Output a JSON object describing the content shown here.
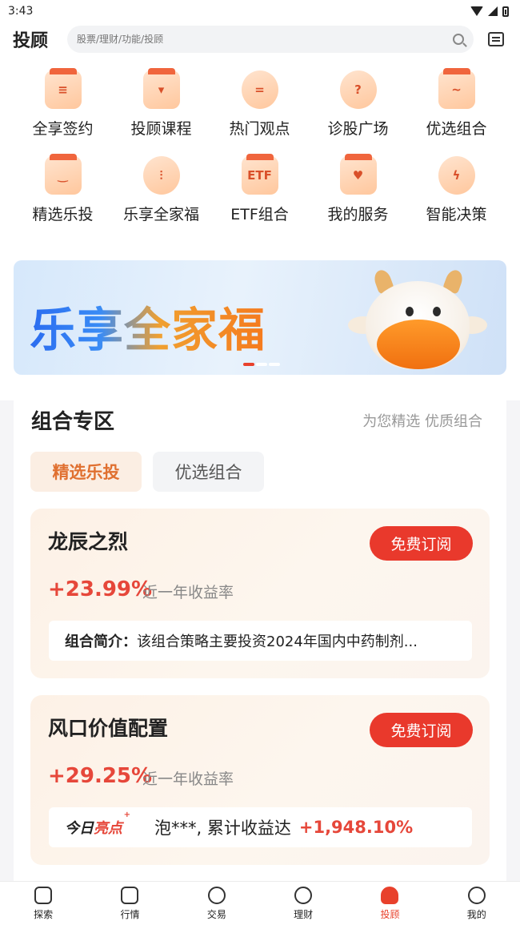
{
  "status_bar": {
    "time": "3:43"
  },
  "header": {
    "title": "投顾",
    "search_placeholder": "股票/理财/功能/投顾"
  },
  "grid": [
    {
      "label": "全享签约",
      "icon": "contract-icon",
      "mark": "≡"
    },
    {
      "label": "投顾课程",
      "icon": "course-book-icon",
      "mark": "▾"
    },
    {
      "label": "热门观点",
      "icon": "hot-opinion-icon",
      "mark": "="
    },
    {
      "label": "诊股广场",
      "icon": "stock-diagnosis-icon",
      "mark": "?"
    },
    {
      "label": "优选组合",
      "icon": "portfolio-chart-icon",
      "mark": "~"
    },
    {
      "label": "精选乐投",
      "icon": "smile-box-icon",
      "mark": "‿"
    },
    {
      "label": "乐享全家福",
      "icon": "family-candle-icon",
      "mark": "⫶"
    },
    {
      "label": "ETF组合",
      "icon": "etf-icon",
      "mark": "ETF"
    },
    {
      "label": "我的服务",
      "icon": "heart-service-icon",
      "mark": "♥"
    },
    {
      "label": "智能决策",
      "icon": "lightbulb-icon",
      "mark": "ϟ"
    }
  ],
  "banner": {
    "text": "乐享全家福"
  },
  "section": {
    "title": "组合专区",
    "subtitle": "为您精选 优质组合",
    "tabs": [
      {
        "label": "精选乐投",
        "active": true
      },
      {
        "label": "优选组合",
        "active": false
      }
    ]
  },
  "portfolios": [
    {
      "name": "龙辰之烈",
      "button": "免费订阅",
      "return": "+23.99%",
      "return_label": "近一年收益率",
      "intro_label": "组合简介：",
      "intro": "该组合策略主要投资2024年国内中药制剂..."
    },
    {
      "name": "风口价值配置",
      "button": "免费订阅",
      "return": "+29.25%",
      "return_label": "近一年收益率",
      "highlight_badge_a": "今日",
      "highlight_badge_b": "亮点",
      "highlight_user": "泡***, 累计收益达",
      "highlight_value": "+1,948.10%"
    }
  ],
  "tabbar": [
    {
      "label": "探索",
      "icon": "explore-icon",
      "active": false
    },
    {
      "label": "行情",
      "icon": "market-chart-icon",
      "active": false
    },
    {
      "label": "交易",
      "icon": "yen-shield-icon",
      "active": false
    },
    {
      "label": "理财",
      "icon": "money-bag-icon",
      "active": false
    },
    {
      "label": "投顾",
      "icon": "advisor-person-icon",
      "active": true
    },
    {
      "label": "我的",
      "icon": "profile-face-icon",
      "active": false
    }
  ],
  "colors": {
    "accent": "#e9392c",
    "return_red": "#e6473a",
    "tab_active_text": "#e07030"
  }
}
